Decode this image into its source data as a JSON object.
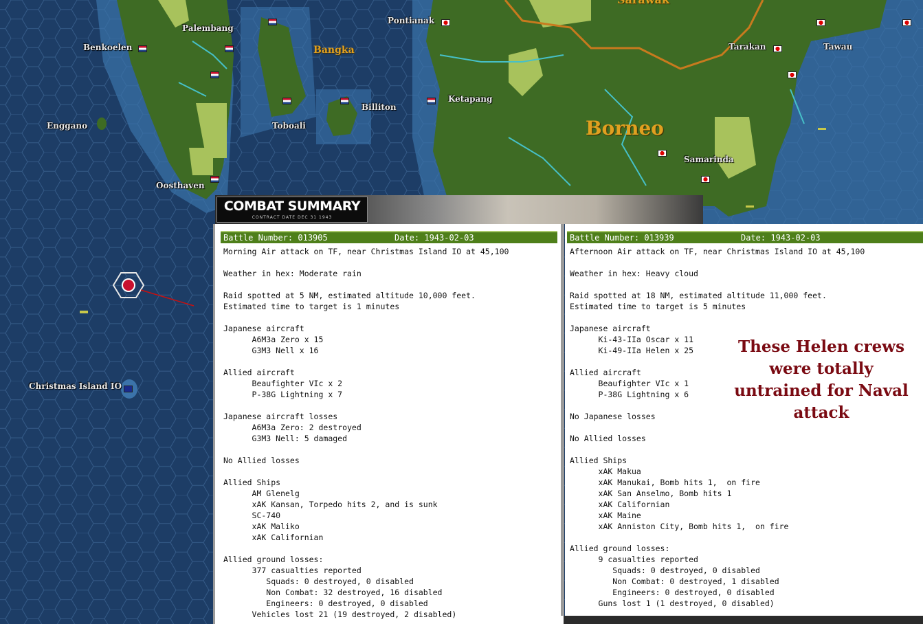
{
  "map": {
    "places": {
      "benkoelen": "Benkoelen",
      "palembang": "Palembang",
      "pontianak": "Pontianak",
      "enggano": "Enggano",
      "toboali": "Toboali",
      "billiton": "Billiton",
      "ketapang": "Ketapang",
      "oosthaven": "Oosthaven",
      "tarakan": "Tarakan",
      "tawau": "Tawau",
      "samarinda": "Samarinda",
      "christmas_island": "Christmas Island IO"
    },
    "regions": {
      "bangka": "Bangka",
      "borneo": "Borneo",
      "sarawak": "Sarawak"
    },
    "colors": {
      "sea": "#1d3d66",
      "jungle": "#3e6b24",
      "clear": "#a8c25c",
      "border": "#c87a1e",
      "river": "#46c0c8"
    }
  },
  "combat_summary": {
    "logo_title": "COMBAT SUMMARY",
    "logo_sub": "CONTRACT DATE DEC 31 1943",
    "left": {
      "battle": "Battle Number: 013905",
      "date": "Date: 1943-02-03",
      "report": "Morning Air attack on TF, near Christmas Island IO at 45,100\n\nWeather in hex: Moderate rain\n\nRaid spotted at 5 NM, estimated altitude 10,000 feet.\nEstimated time to target is 1 minutes\n\nJapanese aircraft\n      A6M3a Zero x 15\n      G3M3 Nell x 16\n\nAllied aircraft\n      Beaufighter VIc x 2\n      P-38G Lightning x 7\n\nJapanese aircraft losses\n      A6M3a Zero: 2 destroyed\n      G3M3 Nell: 5 damaged\n\nNo Allied losses\n\nAllied Ships\n      AM Glenelg\n      xAK Kansan, Torpedo hits 2, and is sunk\n      SC-740\n      xAK Maliko\n      xAK Californian\n\nAllied ground losses:\n      377 casualties reported\n         Squads: 0 destroyed, 0 disabled\n         Non Combat: 32 destroyed, 16 disabled\n         Engineers: 0 destroyed, 0 disabled\n      Vehicles lost 21 (19 destroyed, 2 disabled)"
    },
    "right": {
      "battle": "Battle Number: 013939",
      "date": "Date: 1943-02-03",
      "report": "Afternoon Air attack on TF, near Christmas Island IO at 45,100\n\nWeather in hex: Heavy cloud\n\nRaid spotted at 18 NM, estimated altitude 11,000 feet.\nEstimated time to target is 5 minutes\n\nJapanese aircraft\n      Ki-43-IIa Oscar x 11\n      Ki-49-IIa Helen x 25\n\nAllied aircraft\n      Beaufighter VIc x 1\n      P-38G Lightning x 6\n\nNo Japanese losses\n\nNo Allied losses\n\nAllied Ships\n      xAK Makua\n      xAK Manukai, Bomb hits 1,  on fire\n      xAK San Anselmo, Bomb hits 1\n      xAK Californian\n      xAK Maine\n      xAK Anniston City, Bomb hits 1,  on fire\n\nAllied ground losses:\n      9 casualties reported\n         Squads: 0 destroyed, 0 disabled\n         Non Combat: 0 destroyed, 1 disabled\n         Engineers: 0 destroyed, 0 disabled\n      Guns lost 1 (1 destroyed, 0 disabled)"
    },
    "annotation": "These Helen crews were totally untrained for Naval attack",
    "annotation_color": "#7a0a12",
    "header_color": "#4e7f1a"
  }
}
